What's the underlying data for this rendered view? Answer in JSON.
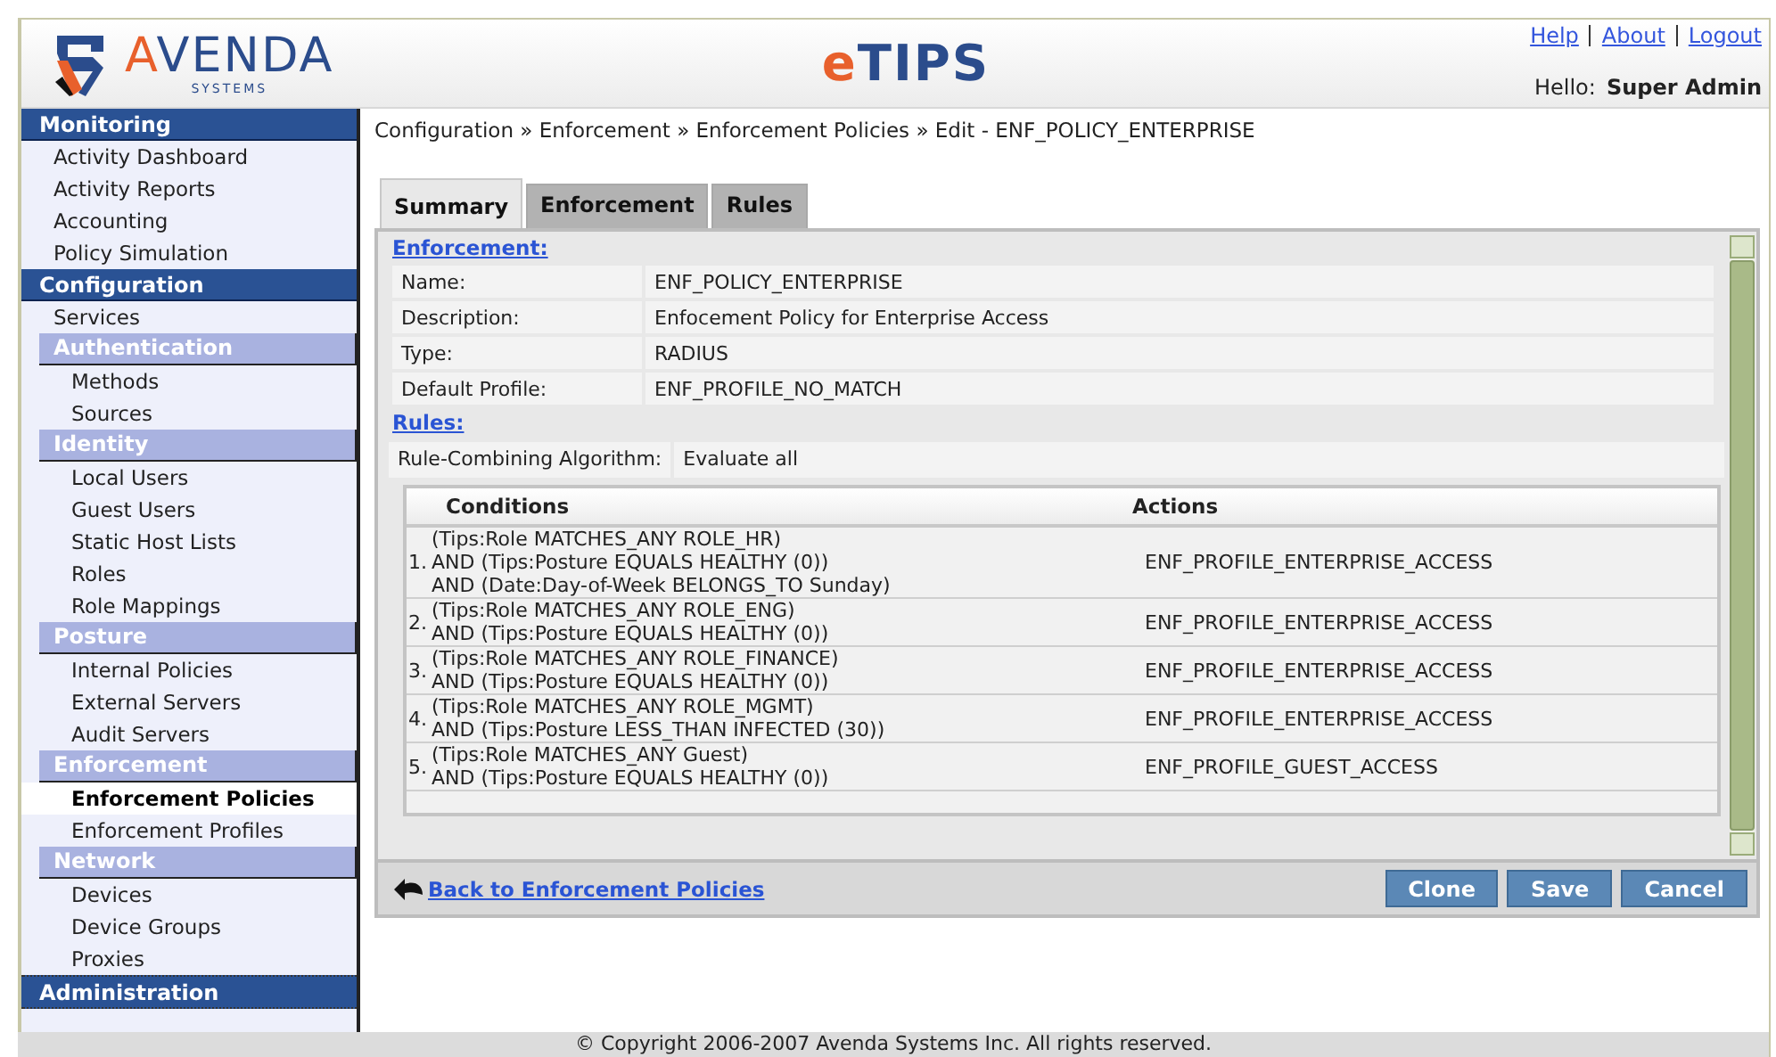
{
  "header": {
    "logo": {
      "name": "AVENDA",
      "tagline": "SYSTEMS"
    },
    "app_title": "eTIPS",
    "links": [
      "Help",
      "About",
      "Logout"
    ],
    "greeting": {
      "label": "Hello:",
      "user": "Super Admin"
    }
  },
  "sidebar": [
    {
      "title": "Monitoring",
      "items": [
        {
          "label": "Activity Dashboard",
          "selected": false
        },
        {
          "label": "Activity Reports",
          "selected": false
        },
        {
          "label": "Accounting",
          "selected": false
        },
        {
          "label": "Policy Simulation",
          "selected": false
        }
      ]
    },
    {
      "title": "Configuration",
      "items": [
        {
          "label": "Services",
          "selected": false
        },
        {
          "label": "Authentication",
          "children": [
            {
              "label": "Methods",
              "selected": false
            },
            {
              "label": "Sources",
              "selected": false
            }
          ]
        },
        {
          "label": "Identity",
          "children": [
            {
              "label": "Local Users",
              "selected": false
            },
            {
              "label": "Guest Users",
              "selected": false
            },
            {
              "label": "Static Host Lists",
              "selected": false
            },
            {
              "label": "Roles",
              "selected": false
            },
            {
              "label": "Role Mappings",
              "selected": false
            }
          ]
        },
        {
          "label": "Posture",
          "children": [
            {
              "label": "Internal Policies",
              "selected": false
            },
            {
              "label": "External Servers",
              "selected": false
            },
            {
              "label": "Audit Servers",
              "selected": false
            }
          ]
        },
        {
          "label": "Enforcement",
          "children": [
            {
              "label": "Enforcement Policies",
              "selected": true
            },
            {
              "label": "Enforcement Profiles",
              "selected": false
            }
          ]
        },
        {
          "label": "Network",
          "children": [
            {
              "label": "Devices",
              "selected": false
            },
            {
              "label": "Device Groups",
              "selected": false
            },
            {
              "label": "Proxies",
              "selected": false
            }
          ]
        }
      ]
    },
    {
      "title": "Administration"
    }
  ],
  "breadcrumb": "Configuration » Enforcement » Enforcement Policies » Edit - ENF_POLICY_ENTERPRISE",
  "tabs": [
    {
      "label": "Summary",
      "selected": true
    },
    {
      "label": "Enforcement",
      "selected": false
    },
    {
      "label": "Rules",
      "selected": false
    }
  ],
  "enforcement": {
    "heading": "Enforcement:",
    "fields": [
      {
        "label": "Name:",
        "value": "ENF_POLICY_ENTERPRISE"
      },
      {
        "label": "Description:",
        "value": "Enfocement Policy for Enterprise Access"
      },
      {
        "label": "Type:",
        "value": "RADIUS"
      },
      {
        "label": "Default Profile:",
        "value": "ENF_PROFILE_NO_MATCH"
      }
    ]
  },
  "rules": {
    "heading": "Rules:",
    "algorithm": {
      "label": "Rule-Combining Algorithm:",
      "value": "Evaluate all"
    },
    "columns": [
      "Conditions",
      "Actions"
    ],
    "rows": [
      {
        "number": "1.",
        "conditions": [
          "(Tips:Role MATCHES_ANY ROLE_HR)",
          "AND (Tips:Posture EQUALS HEALTHY (0))",
          "AND (Date:Day-of-Week BELONGS_TO Sunday)"
        ],
        "action": "ENF_PROFILE_ENTERPRISE_ACCESS"
      },
      {
        "number": "2.",
        "conditions": [
          "(Tips:Role MATCHES_ANY ROLE_ENG)",
          "AND (Tips:Posture EQUALS HEALTHY (0))"
        ],
        "action": "ENF_PROFILE_ENTERPRISE_ACCESS"
      },
      {
        "number": "3.",
        "conditions": [
          "(Tips:Role MATCHES_ANY ROLE_FINANCE)",
          "AND (Tips:Posture EQUALS HEALTHY (0))"
        ],
        "action": "ENF_PROFILE_ENTERPRISE_ACCESS"
      },
      {
        "number": "4.",
        "conditions": [
          "(Tips:Role MATCHES_ANY ROLE_MGMT)",
          "AND (Tips:Posture LESS_THAN INFECTED (30))"
        ],
        "action": "ENF_PROFILE_ENTERPRISE_ACCESS"
      },
      {
        "number": "5.",
        "conditions": [
          "(Tips:Role MATCHES_ANY Guest)",
          "AND (Tips:Posture EQUALS HEALTHY (0))"
        ],
        "action": "ENF_PROFILE_GUEST_ACCESS"
      }
    ]
  },
  "back_link": "Back to Enforcement Policies",
  "buttons": [
    "Clone",
    "Save",
    "Cancel"
  ],
  "footer": "© Copyright 2006-2007 Avenda Systems Inc. All rights reserved."
}
